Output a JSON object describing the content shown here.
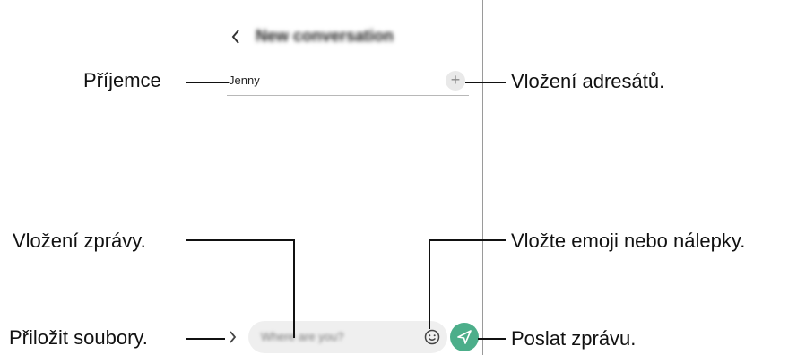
{
  "header": {
    "title": "New conversation"
  },
  "recipient": {
    "name": "Jenny",
    "add_symbol": "+"
  },
  "composer": {
    "placeholder": "Where are you?"
  },
  "callouts": {
    "recipient": "Příjemce",
    "add_recipients": "Vložení adresátů.",
    "message_field": "Vložení zprávy.",
    "emoji": "Vložte emoji nebo nálepky.",
    "attach": "Přiložit soubory.",
    "send": "Poslat zprávu."
  },
  "colors": {
    "send_button": "#4cae8a",
    "input_background": "#efefef",
    "frame": "#9a9a9a"
  },
  "icons": [
    "back-icon",
    "add-icon",
    "attach-icon",
    "emoji-icon",
    "send-icon"
  ]
}
